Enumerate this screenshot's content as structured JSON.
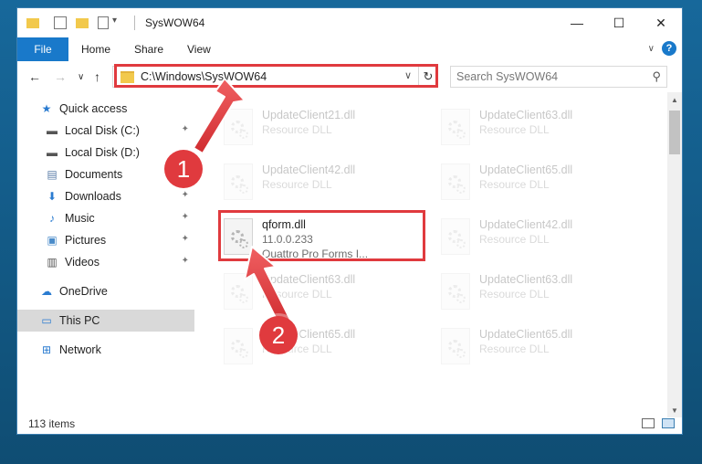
{
  "window": {
    "title": "SysWOW64"
  },
  "ribbon": {
    "tabs": [
      "File",
      "Home",
      "Share",
      "View"
    ]
  },
  "address": {
    "path": "C:\\Windows\\SysWOW64",
    "search_placeholder": "Search SysWOW64"
  },
  "sidebar": {
    "items": [
      {
        "label": "Quick access",
        "icon": "star-icon"
      },
      {
        "label": "Local Disk (C:)",
        "icon": "drive-icon",
        "pinned": true
      },
      {
        "label": "Local Disk (D:)",
        "icon": "drive-icon"
      },
      {
        "label": "Documents",
        "icon": "documents-icon"
      },
      {
        "label": "Downloads",
        "icon": "download-icon",
        "pinned": true
      },
      {
        "label": "Music",
        "icon": "music-icon",
        "pinned": true
      },
      {
        "label": "Pictures",
        "icon": "pictures-icon",
        "pinned": true
      },
      {
        "label": "Videos",
        "icon": "videos-icon",
        "pinned": true
      },
      {
        "label": "OneDrive",
        "icon": "cloud-icon"
      },
      {
        "label": "This PC",
        "icon": "pc-icon",
        "selected": true
      },
      {
        "label": "Network",
        "icon": "network-icon"
      }
    ]
  },
  "files": {
    "left": [
      {
        "name": "UpdateClient21.dll",
        "desc": "Resource DLL"
      },
      {
        "name": "UpdateClient42.dll",
        "desc": "Resource DLL"
      },
      {
        "name": "qform.dll",
        "version": "11.0.0.233",
        "desc": "Quattro Pro Forms I..."
      },
      {
        "name": "UpdateClient63.dll",
        "desc": "Resource DLL"
      },
      {
        "name": "UpdateClient65.dll",
        "desc": "Resource DLL"
      }
    ],
    "right": [
      {
        "name": "UpdateClient63.dll",
        "desc": "Resource DLL"
      },
      {
        "name": "UpdateClient65.dll",
        "desc": "Resource DLL"
      },
      {
        "name": "UpdateClient42.dll",
        "desc": "Resource DLL"
      },
      {
        "name": "UpdateClient63.dll",
        "desc": "Resource DLL"
      },
      {
        "name": "UpdateClient65.dll",
        "desc": "Resource DLL"
      }
    ]
  },
  "status": {
    "items": "113 items"
  },
  "annotations": {
    "step1": "1",
    "step2": "2",
    "color": "#e03a3e"
  }
}
